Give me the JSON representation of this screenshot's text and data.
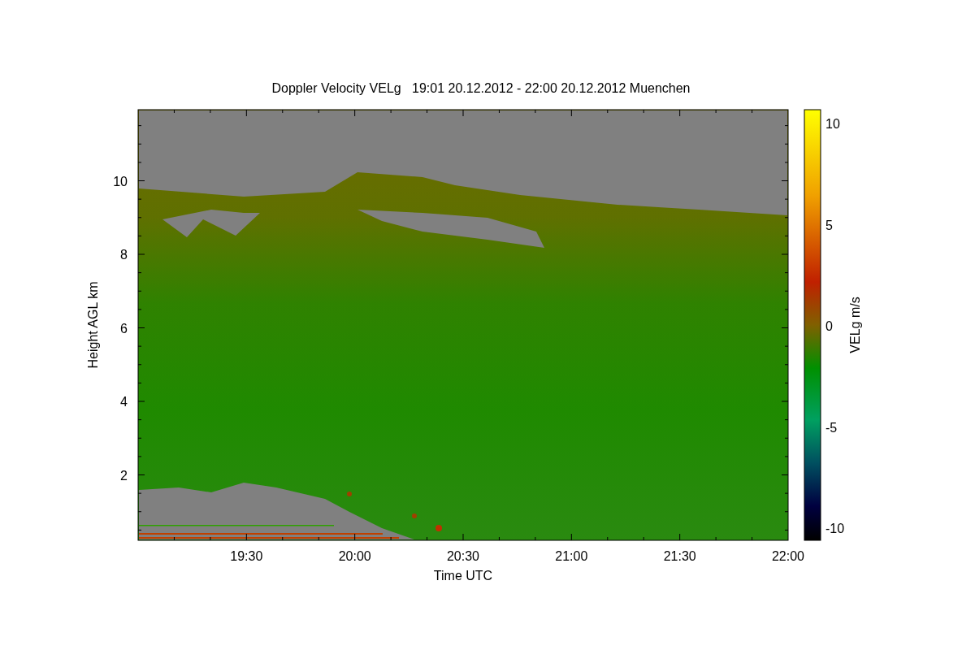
{
  "title": "Doppler Velocity VELg   19:01 20.12.2012 - 22:00 20.12.2012 Muenchen",
  "xlabel": "Time UTC",
  "ylabel": "Height AGL km",
  "xticks": [
    "19:30",
    "20:00",
    "20:30",
    "21:00",
    "21:30",
    "22:00"
  ],
  "yticks": [
    "10",
    "8",
    "6",
    "4",
    "2"
  ],
  "colorbar": {
    "label": "VELg m/s",
    "ticks": [
      "10",
      "5",
      "0",
      "-5",
      "-10"
    ]
  }
}
